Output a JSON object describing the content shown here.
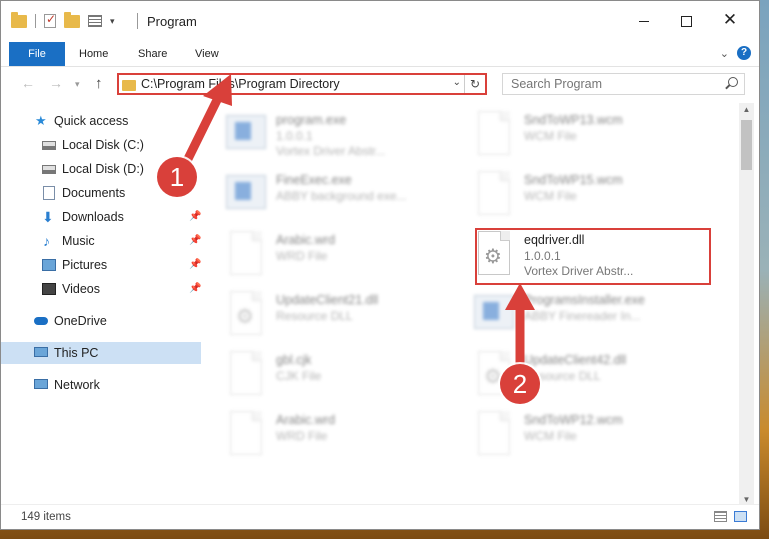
{
  "window": {
    "title": "Program",
    "controls": {
      "minimize": "",
      "maximize": "",
      "close": "✕"
    }
  },
  "ribbon": {
    "tabs": [
      "File",
      "Home",
      "Share",
      "View"
    ],
    "help": "?"
  },
  "nav": {
    "address": "C:\\Program Files\\Program Directory",
    "search_placeholder": "Search Program"
  },
  "sidebar": {
    "items": [
      {
        "label": "Quick access",
        "icon": "star-icon"
      },
      {
        "label": "Local Disk (C:)",
        "icon": "drive-icon"
      },
      {
        "label": "Local Disk (D:)",
        "icon": "drive-icon"
      },
      {
        "label": "Documents",
        "icon": "documents-icon"
      },
      {
        "label": "Downloads",
        "icon": "downloads-icon"
      },
      {
        "label": "Music",
        "icon": "music-icon"
      },
      {
        "label": "Pictures",
        "icon": "pictures-icon"
      },
      {
        "label": "Videos",
        "icon": "videos-icon"
      },
      {
        "label": "OneDrive",
        "icon": "onedrive-icon"
      },
      {
        "label": "This PC",
        "icon": "this-pc-icon"
      },
      {
        "label": "Network",
        "icon": "network-icon"
      }
    ]
  },
  "files": [
    {
      "name": "program.exe",
      "l2": "1.0.0.1",
      "l3": "Vortex Driver Abstr..."
    },
    {
      "name": "SndToWP13.wcm",
      "l2": "WCM File",
      "l3": ""
    },
    {
      "name": "FineExec.exe",
      "l2": "ABBY background exe...",
      "l3": ""
    },
    {
      "name": "SndToWP15.wcm",
      "l2": "WCM File",
      "l3": ""
    },
    {
      "name": "Arabic.wrd",
      "l2": "WRD File",
      "l3": ""
    },
    {
      "name": "eqdriver.dll",
      "l2": "1.0.0.1",
      "l3": "Vortex Driver Abstr..."
    },
    {
      "name": "UpdateClient21.dll",
      "l2": "Resource DLL",
      "l3": ""
    },
    {
      "name": "ProgramsInstaller.exe",
      "l2": "ABBY Finereader In...",
      "l3": ""
    },
    {
      "name": "gbl.cjk",
      "l2": "CJK File",
      "l3": ""
    },
    {
      "name": "UpdateClient42.dll",
      "l2": "Resource DLL",
      "l3": ""
    },
    {
      "name": "Arabic.wrd",
      "l2": "WRD File",
      "l3": ""
    },
    {
      "name": "SndToWP12.wcm",
      "l2": "WCM File",
      "l3": ""
    }
  ],
  "status": {
    "count": "149 items"
  },
  "callouts": {
    "step1": "1",
    "step2": "2"
  },
  "colors": {
    "accent": "#1a6fc4",
    "highlight": "#d9403a"
  }
}
